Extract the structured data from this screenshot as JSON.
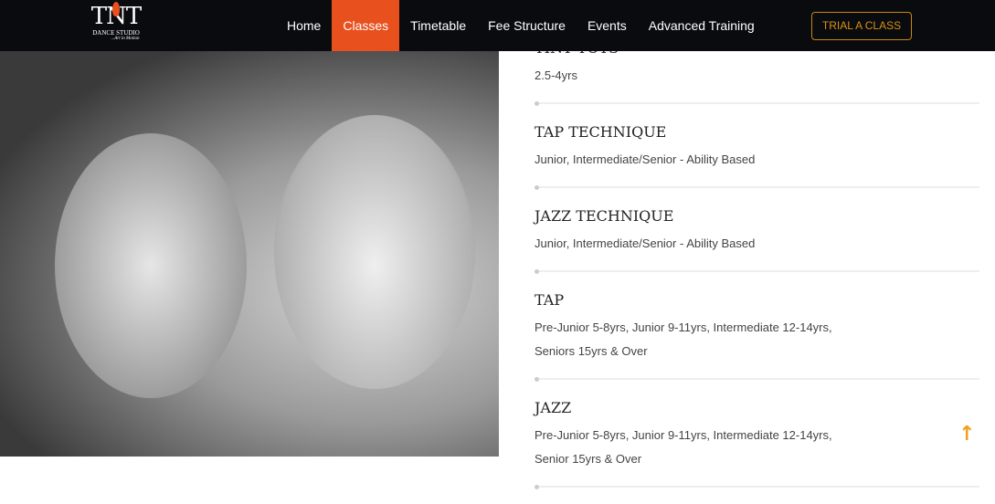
{
  "brand": {
    "name": "TNT",
    "subtitle": "DANCE STUDIO",
    "tagline": "...Art in Motion"
  },
  "nav": [
    {
      "label": "Home"
    },
    {
      "label": "Classes",
      "active": true
    },
    {
      "label": "Timetable"
    },
    {
      "label": "Fee Structure"
    },
    {
      "label": "Events"
    },
    {
      "label": "Advanced Training"
    }
  ],
  "cta": "TRIAL A CLASS",
  "classes": [
    {
      "title": "TINY TOTS",
      "desc": "2.5-4yrs"
    },
    {
      "title": "TAP TECHNIQUE",
      "desc": "Junior, Intermediate/Senior - Ability Based"
    },
    {
      "title": "JAZZ TECHNIQUE",
      "desc": "Junior, Intermediate/Senior - Ability Based"
    },
    {
      "title": "TAP",
      "desc": "Pre-Junior 5-8yrs, Junior 9-11yrs, Intermediate 12-14yrs, Seniors 15yrs & Over"
    },
    {
      "title": "JAZZ",
      "desc": "Pre-Junior 5-8yrs, Junior 9-11yrs, Intermediate 12-14yrs, Senior 15yrs & Over"
    }
  ],
  "colors": {
    "accent": "#e8501d",
    "cta": "#d4920f",
    "header": "#0a0b0f"
  }
}
